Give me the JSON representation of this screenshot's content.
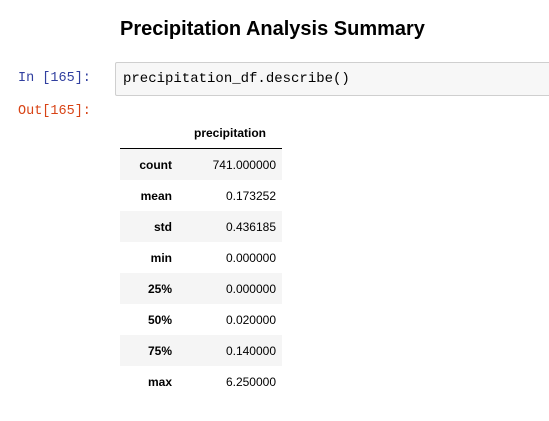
{
  "heading": "Precipitation Analysis Summary",
  "cell": {
    "in_prompt": "In [165]:",
    "code": "precipitation_df.describe()",
    "out_prompt": "Out[165]:"
  },
  "table": {
    "columns": [
      "precipitation"
    ],
    "rows": [
      {
        "label": "count",
        "value": "741.000000"
      },
      {
        "label": "mean",
        "value": "0.173252"
      },
      {
        "label": "std",
        "value": "0.436185"
      },
      {
        "label": "min",
        "value": "0.000000"
      },
      {
        "label": "25%",
        "value": "0.000000"
      },
      {
        "label": "50%",
        "value": "0.020000"
      },
      {
        "label": "75%",
        "value": "0.140000"
      },
      {
        "label": "max",
        "value": "6.250000"
      }
    ]
  },
  "colors": {
    "in_prompt": "#303f9f",
    "out_prompt": "#d84315",
    "input_background": "#f7f7f7",
    "input_border": "#cfcfcf",
    "row_stripe": "#f5f5f5"
  }
}
